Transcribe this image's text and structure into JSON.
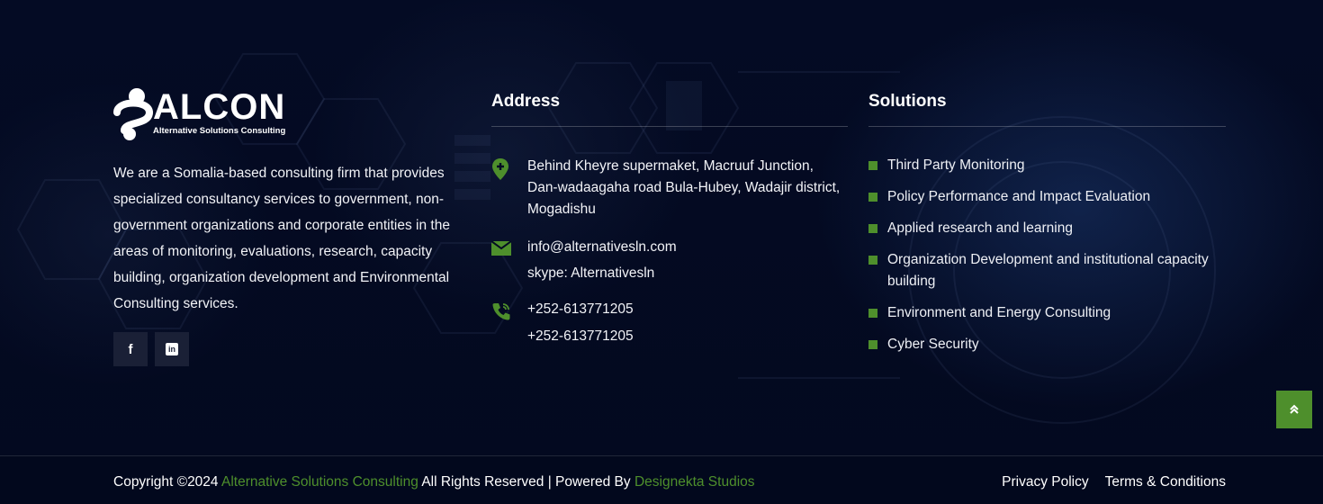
{
  "brand": {
    "logo_text": "ALCON",
    "logo_subtitle": "Alternative Solutions Consulting",
    "about": "We are a Somalia-based consulting firm that provides specialized consultancy services to government, non-government organizations and corporate entities in the areas of monitoring, evaluations, research, capacity building, organization development and Environmental Consulting services.",
    "social": [
      {
        "icon": "facebook-icon",
        "glyph": "f"
      },
      {
        "icon": "linkedin-icon",
        "glyph": "in"
      }
    ]
  },
  "address": {
    "title": "Address",
    "location": [
      "Behind Kheyre supermaket, Macruuf Junction,",
      "Dan-wadaagaha road Bula-Hubey, Wadajir district,",
      "Mogadishu"
    ],
    "email": "info@alternativesln.com",
    "skype": "skype: Alternativesln",
    "phones": [
      "+252-613771205",
      "+252-613771205"
    ]
  },
  "solutions": {
    "title": "Solutions",
    "items": [
      "Third Party Monitoring",
      "Policy Performance and Impact Evaluation",
      "Applied research and learning",
      "Organization Development and institutional capacity building",
      "Environment and Energy Consulting",
      "Cyber Security"
    ]
  },
  "footer": {
    "copyright_prefix": "Copyright ©2024",
    "company": "Alternative Solutions Consulting",
    "rights": "All Rights Reserved | Powered By",
    "powered_by": "Designekta Studios",
    "links": [
      "Privacy Policy",
      "Terms & Conditions"
    ]
  },
  "colors": {
    "accent": "#4e8f2c",
    "background": "#030a22",
    "social_bg": "#1a2036"
  }
}
